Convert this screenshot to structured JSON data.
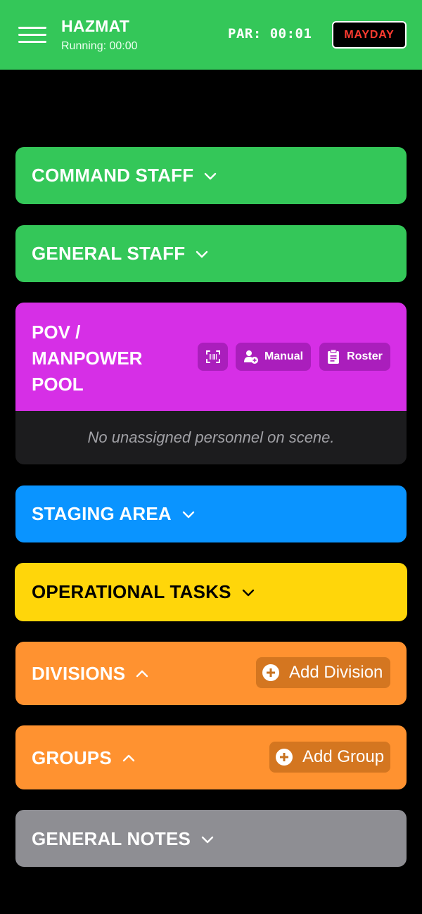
{
  "header": {
    "title": "HAZMAT",
    "running": "Running: 00:00",
    "par": "PAR: 00:01",
    "mayday_label": "MAYDAY"
  },
  "sections": {
    "command_staff": {
      "title": "COMMAND STAFF",
      "state": "collapsed",
      "color": "#34c759"
    },
    "general_staff": {
      "title": "GENERAL STAFF",
      "state": "collapsed",
      "color": "#34c759"
    },
    "pov": {
      "title_lines": [
        "POV /",
        "MANPOWER",
        "POOL"
      ],
      "color": "#d62fe6",
      "scan_icon": "barcode-scan-icon",
      "manual_label": "Manual",
      "roster_label": "Roster",
      "empty_text": "No unassigned personnel on scene."
    },
    "staging_area": {
      "title": "STAGING AREA",
      "state": "collapsed",
      "color": "#0a94ff"
    },
    "operational_tasks": {
      "title": "OPERATIONAL TASKS",
      "state": "collapsed",
      "color": "#ffd60a"
    },
    "divisions": {
      "title": "DIVISIONS",
      "state": "expanded",
      "add_label": "Add Division",
      "color": "#ff9230"
    },
    "groups": {
      "title": "GROUPS",
      "state": "expanded",
      "add_label": "Add Group",
      "color": "#ff9230"
    },
    "general_notes": {
      "title": "GENERAL NOTES",
      "state": "collapsed",
      "color": "#8e8e93"
    }
  }
}
